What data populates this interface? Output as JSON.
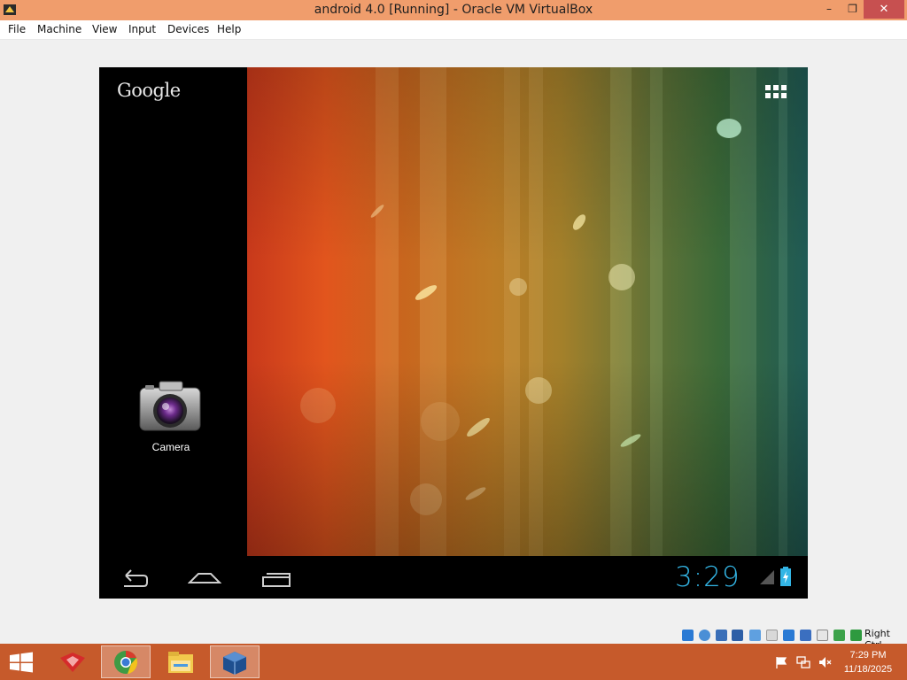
{
  "window": {
    "title": "android 4.0 [Running] - Oracle VM VirtualBox",
    "minimize_glyph": "–",
    "restore_glyph": "❐",
    "close_glyph": "✕"
  },
  "menubar": {
    "items": [
      "File",
      "Machine",
      "View",
      "Input",
      "Devices",
      "Help"
    ]
  },
  "android": {
    "google_label": "Google",
    "apps_icon": "all-apps-grid-icon",
    "shortcut": {
      "label": "Camera",
      "icon": "camera-icon"
    },
    "nav": {
      "back_icon": "back-icon",
      "home_icon": "home-icon",
      "recents_icon": "recent-apps-icon"
    },
    "clock": "3:29",
    "signal_icon": "signal-icon",
    "battery_icon": "battery-charging-icon",
    "accent": "#33b5e5"
  },
  "vbox_status": {
    "host_key_label": "Right Ctrl",
    "icons": [
      "hard-disk-icon",
      "optical-disk-icon",
      "usb-icon",
      "shared-folders-icon",
      "display-icon",
      "network-icon",
      "display-icon",
      "video-capture-icon",
      "mouse-integration-icon",
      "keyboard-capture-icon"
    ]
  },
  "taskbar": {
    "start_icon": "windows-start-icon",
    "apps": [
      "app-icon",
      "chrome-icon",
      "file-explorer-icon",
      "virtualbox-icon"
    ],
    "tray_icons": [
      "action-center-flag-icon",
      "network-icon",
      "volume-muted-icon"
    ],
    "time": "7:29 PM",
    "date": "11/18/2025"
  }
}
